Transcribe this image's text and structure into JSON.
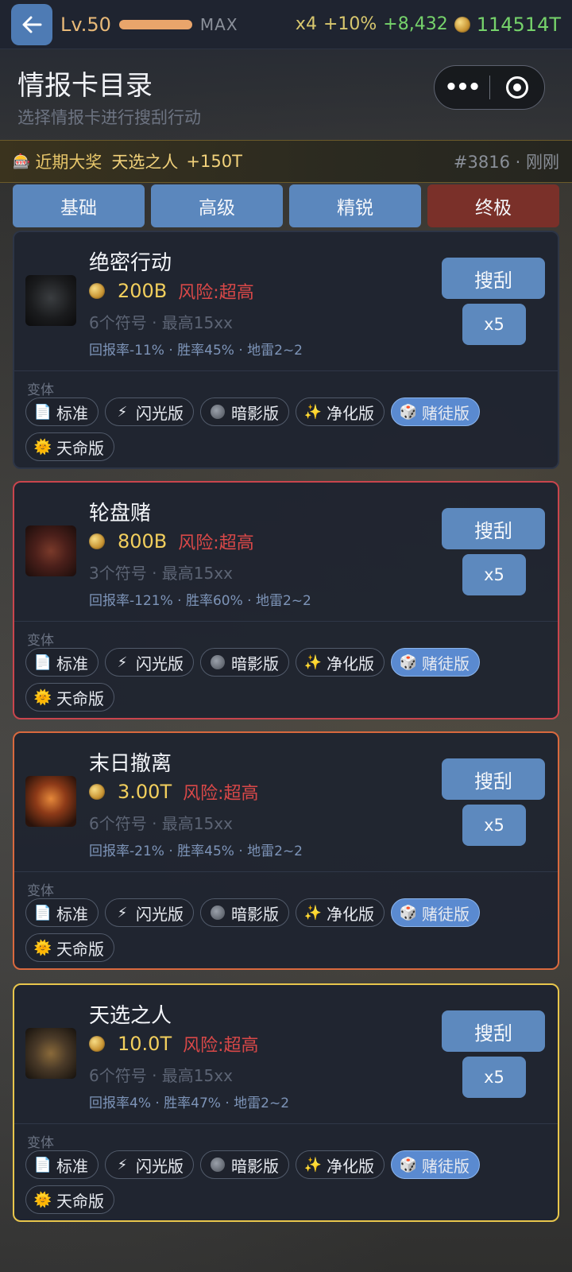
{
  "topbar": {
    "level": "Lv.50",
    "max_label": "MAX",
    "multiplier": "x4",
    "bonus_pct": "+10%",
    "gain": "+8,432",
    "balance": "114514T"
  },
  "header": {
    "title": "情报卡目录",
    "subtitle": "选择情报卡进行搜刮行动"
  },
  "jackpot": {
    "label": "近期大奖",
    "card": "天选之人",
    "amount": "+150T",
    "meta": "#3816 · 刚刚"
  },
  "tabs": [
    "基础",
    "高级",
    "精锐",
    "终极"
  ],
  "active_tab": "终极",
  "cards": [
    {
      "name": "绝密行动",
      "price": "200B",
      "risk": "风险:超高",
      "symbols": "6个符号 · 最高15xx",
      "stats": "回报率-11% · 胜率45% · 地雷2~2",
      "scrape": "搜刮",
      "x5": "x5",
      "variant_label": "变体"
    },
    {
      "name": "轮盘赌",
      "price": "800B",
      "risk": "风险:超高",
      "symbols": "3个符号 · 最高15xx",
      "stats": "回报率-121% · 胜率60% · 地雷2~2",
      "scrape": "搜刮",
      "x5": "x5",
      "variant_label": "变体"
    },
    {
      "name": "末日撤离",
      "price": "3.00T",
      "risk": "风险:超高",
      "symbols": "6个符号 · 最高15xx",
      "stats": "回报率-21% · 胜率45% · 地雷2~2",
      "scrape": "搜刮",
      "x5": "x5",
      "variant_label": "变体"
    },
    {
      "name": "天选之人",
      "price": "10.0T",
      "risk": "风险:超高",
      "symbols": "6个符号 · 最高15xx",
      "stats": "回报率4% · 胜率47% · 地雷2~2",
      "scrape": "搜刮",
      "x5": "x5",
      "variant_label": "变体"
    }
  ],
  "variants": [
    {
      "label": "标准",
      "icon": "document-icon"
    },
    {
      "label": "闪光版",
      "icon": "lightning-icon"
    },
    {
      "label": "暗影版",
      "icon": "shadow-circle-icon"
    },
    {
      "label": "净化版",
      "icon": "sparkles-icon"
    },
    {
      "label": "赌徒版",
      "icon": "dice-icon",
      "selected": true
    },
    {
      "label": "天命版",
      "icon": "sun-icon"
    }
  ],
  "colors": {
    "accent_blue": "#5d89be",
    "active_tab": "#7a3029",
    "price_gold": "#f2cf5d",
    "risk_red": "#d94848",
    "gain_green": "#76d36b",
    "border_red": "#c9454d",
    "border_orange": "#d9693e",
    "border_gold": "#e8c64c"
  }
}
